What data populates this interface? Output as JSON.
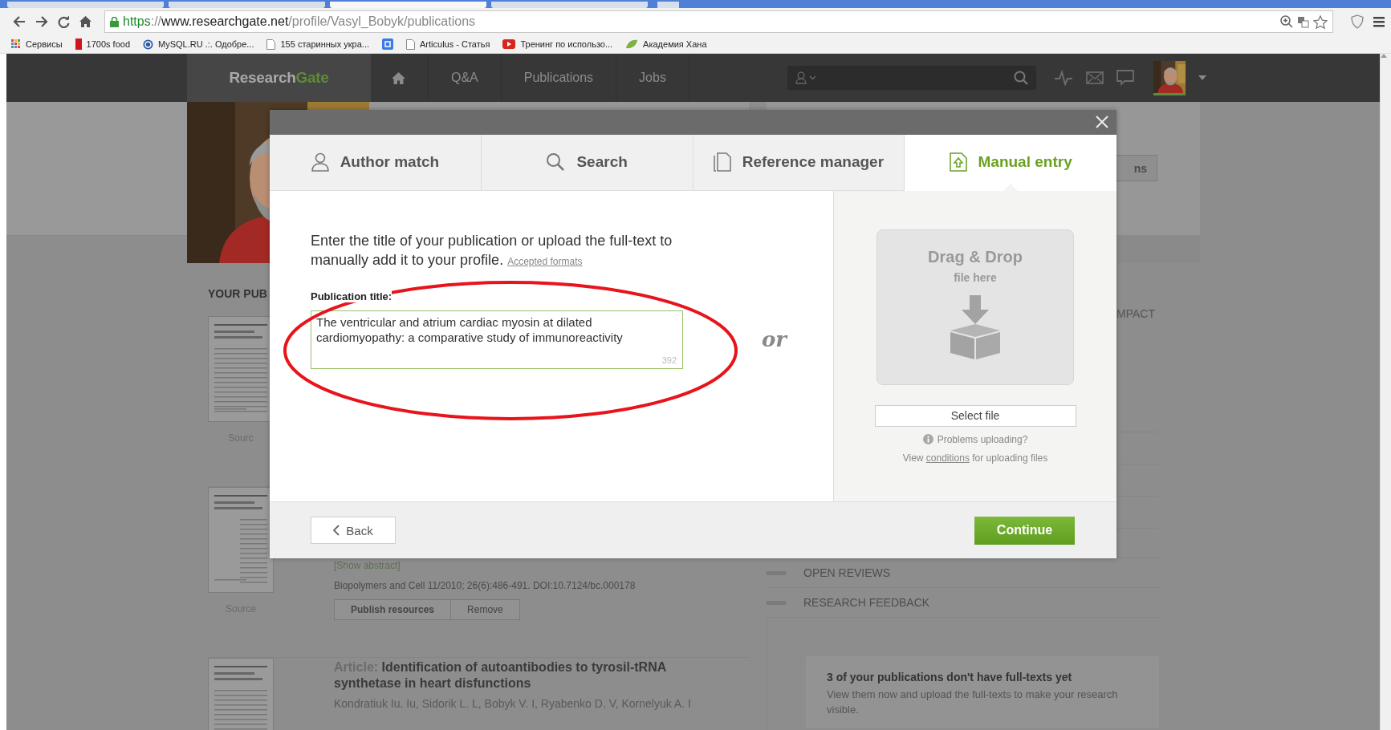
{
  "browser": {
    "tabs": [
      {
        "selected": false
      },
      {
        "selected": false
      },
      {
        "selected": true
      },
      {
        "selected": false
      }
    ],
    "address": {
      "scheme": "https",
      "separator": "://",
      "host": "www.researchgate.net",
      "path": "/profile/Vasyl_Bobyk/publications"
    },
    "bookmarks": [
      {
        "kind": "apps",
        "label": "Сервисы"
      },
      {
        "kind": "red",
        "label": "1700s food"
      },
      {
        "kind": "mysql",
        "label": "MySQL.RU .:. Одобре..."
      },
      {
        "kind": "page",
        "label": "155 старинных укра..."
      },
      {
        "kind": "google"
      },
      {
        "kind": "page",
        "label": "Articulus - Статья"
      },
      {
        "kind": "video",
        "label": "Тренинг по использо..."
      },
      {
        "kind": "leaf",
        "label": "Академия Хана"
      }
    ]
  },
  "navbar": {
    "logo_first": "Research",
    "logo_second": "Gate",
    "links": [
      "Q&A",
      "Publications",
      "Jobs"
    ]
  },
  "profile": {
    "section_heading": "YOUR PUB",
    "header_button": "ns"
  },
  "publications": [
    {
      "source": "Sourc"
    },
    {
      "source": "Source",
      "show_abstract": "[Show abstract]",
      "meta": "Biopolymers and Cell 11/2010; 26(6):486-491. DOI:10.7124/bc.000178",
      "actions": [
        "Publish resources",
        "Remove"
      ]
    },
    {
      "type_label": "Article:",
      "title": "Identification of autoantibodies to tyrosil-tRNA synthetase in heart disfunctions",
      "authors": "Kondratiuk Iu. Iu, Sidorik L. L, Bobyk V. I, Ryabenko D. V, Kornelyuk A. I"
    }
  ],
  "sidebar": {
    "partial_label": "MPACT",
    "links": [
      "OPEN REVIEWS",
      "RESEARCH FEEDBACK"
    ],
    "card": {
      "title": "3 of your publications don't have full-texts yet",
      "text": "View them now and upload the full-texts to make your research visible."
    }
  },
  "dialog": {
    "tabs": [
      {
        "label": "Author match",
        "selected": false
      },
      {
        "label": "Search",
        "selected": false
      },
      {
        "label": "Reference manager",
        "selected": false
      },
      {
        "label": "Manual entry",
        "selected": true
      }
    ],
    "intro": "Enter the title of your publication or upload the full-text to manually add it to your profile.",
    "formats_link": "Accepted formats",
    "field_label": "Publication title:",
    "title_value": "The ventricular and atrium cardiac myosin at dilated cardiomyopathy: a comparative study of immunoreactivity",
    "char_count": "392",
    "or": "or",
    "drop_title": "Drag & Drop",
    "drop_subtitle": "file here",
    "select_button": "Select file",
    "problems_link": "Problems uploading?",
    "conditions": {
      "before": "View",
      "link": "conditions",
      "after": "for uploading files"
    },
    "back": "Back",
    "continue": "Continue"
  }
}
